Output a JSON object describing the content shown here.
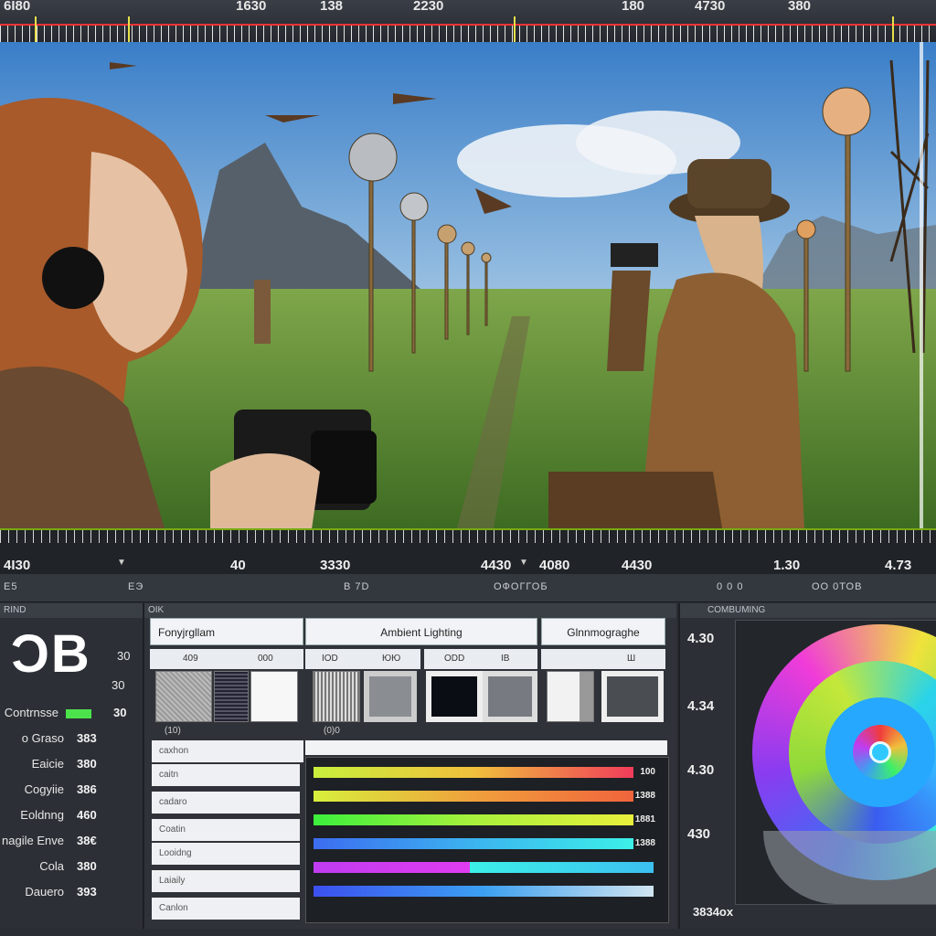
{
  "top_ruler": {
    "labels": [
      "6I80",
      "1630",
      "138",
      "2230",
      "180",
      "4730",
      "380"
    ]
  },
  "timeline": {
    "timecodes": [
      "4I30",
      "40",
      "3330",
      "4430",
      "4080",
      "4430",
      "1.30",
      "4.73"
    ]
  },
  "toolbar": {
    "items": [
      "E5",
      "ЕЭ",
      "B 7D",
      "ОФОГГОБ",
      "0 0 0",
      "ОО 0ТОВ"
    ]
  },
  "left_panel": {
    "header": "RIND",
    "big_value": "ƆB",
    "big_side_a": "30",
    "big_side_b": "30",
    "rows": [
      {
        "label": "Contrnsse",
        "value": "30"
      },
      {
        "label": "o Graso",
        "value": "383"
      },
      {
        "label": "Eaicie",
        "value": "380"
      },
      {
        "label": "Cogyiie",
        "value": "386"
      },
      {
        "label": "Eoldnng",
        "value": "460"
      },
      {
        "label": "nagile Enve",
        "value": "38€"
      },
      {
        "label": "Cola",
        "value": "380"
      },
      {
        "label": "Dauero",
        "value": "393"
      }
    ]
  },
  "mid_panel": {
    "header": "OIK",
    "tabs": [
      "Fonyjrgllam",
      "Ambient Lighting",
      "Glnnmograghe"
    ],
    "subheaders": [
      "409",
      "000",
      "IOD",
      "ЮЮ",
      "ODD",
      "IB",
      "Ш"
    ],
    "swatch_caption": "(10)",
    "swatch_caption2": "(0)0",
    "prop_rows": [
      "caxhon",
      "caitn",
      "cadaro",
      "Coatin",
      "Looidng",
      "Laiaily",
      "Canlon"
    ],
    "bars": [
      {
        "label": "100",
        "fill": 0.92
      },
      {
        "label": "1388",
        "fill": 0.92
      },
      {
        "label": "1881",
        "fill": 0.92
      },
      {
        "label": "1388",
        "fill": 0.92
      },
      {
        "label": "",
        "fill": 0.45
      },
      {
        "label": "",
        "fill": 0.98
      }
    ]
  },
  "right_panel": {
    "header": "COMBUMING",
    "values": [
      "4.30",
      "4.34",
      "4.30",
      "430"
    ],
    "resolution": "3834ox"
  }
}
